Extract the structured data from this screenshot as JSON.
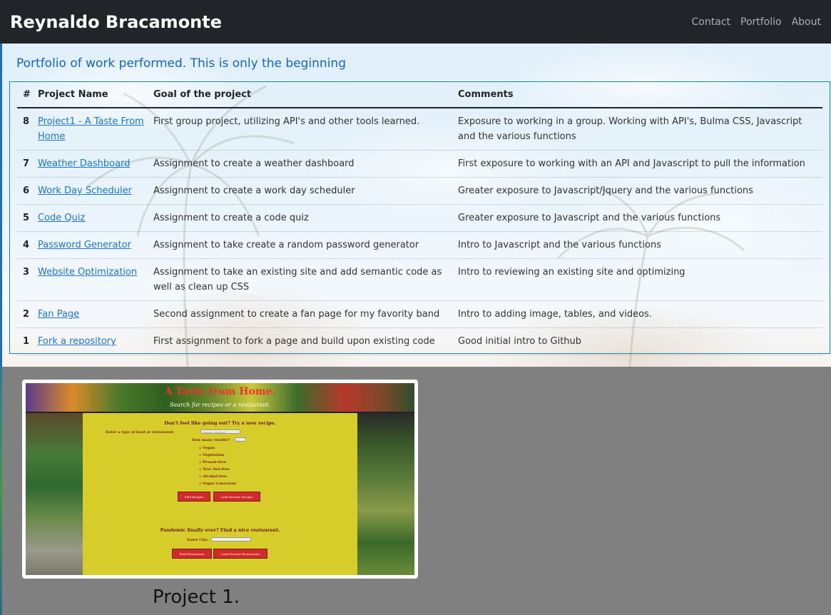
{
  "navbar": {
    "brand": "Reynaldo Bracamonte",
    "links": [
      "Contact",
      "Portfolio",
      "About"
    ]
  },
  "hero": {
    "title": "Portfolio of work performed. This is only the beginning"
  },
  "table": {
    "headers": [
      "#",
      "Project Name",
      "Goal of the project",
      "Comments"
    ],
    "rows": [
      {
        "num": "8",
        "name": "Project1 - A Taste From Home",
        "goal": "First group project, utilizing API's and other tools learned.",
        "comment": "Exposure to working in a group. Working with API's, Bulma CSS, Javascript and the various functions"
      },
      {
        "num": "7",
        "name": "Weather Dashboard",
        "goal": "Assignment to create a weather dashboard",
        "comment": "First exposure to working with an API and Javascript to pull the information"
      },
      {
        "num": "6",
        "name": "Work Day Scheduler",
        "goal": "Assignment to create a work day scheduler",
        "comment": "Greater exposure to Javascript/Jquery and the various functions"
      },
      {
        "num": "5",
        "name": "Code Quiz",
        "goal": "Assignment to create a code quiz",
        "comment": "Greater exposure to Javascript and the various functions"
      },
      {
        "num": "4",
        "name": "Password Generator",
        "goal": "Assignment to take create a random password generator",
        "comment": "Intro to Javascript and the various functions"
      },
      {
        "num": "3",
        "name": "Website Optimization",
        "goal": "Assignment to take an existing site and add semantic code as well as clean up CSS",
        "comment": "Intro to reviewing an existing site and optimizing"
      },
      {
        "num": "2",
        "name": "Fan Page",
        "goal": "Second assignment to create a fan page for my favority band",
        "comment": "Intro to adding image, tables, and videos."
      },
      {
        "num": "1",
        "name": "Fork a repository",
        "goal": "First assignment to fork a page and build upon existing code",
        "comment": "Good initial intro to Github"
      }
    ]
  },
  "project_card": {
    "screenshot": {
      "title": "A Taste from Home.",
      "subtitle": "Search for recipes or a restaurant.",
      "recipe_heading": "Don't feel like going out? Try a new recipe.",
      "food_label": "Enter a type of food or restaurant:",
      "food_placeholder": "Mexican, burgers etc",
      "results_label": "How many results?",
      "results_value": "5",
      "options": [
        "Vegan",
        "Vegetarian",
        "Peanut-free",
        "Tree Nut-free",
        "Alcohol-free",
        "Sugar Conscious"
      ],
      "recipe_buttons": [
        "Find Recipes",
        "Load Favorite Recipes"
      ],
      "restaurant_heading": "Pandemic finally over? Find a nice restaurant.",
      "city_label": "Enter City:",
      "restaurant_buttons": [
        "Find Restaurants",
        "Load Favorite Restaurants"
      ]
    },
    "caption": "Project 1."
  }
}
